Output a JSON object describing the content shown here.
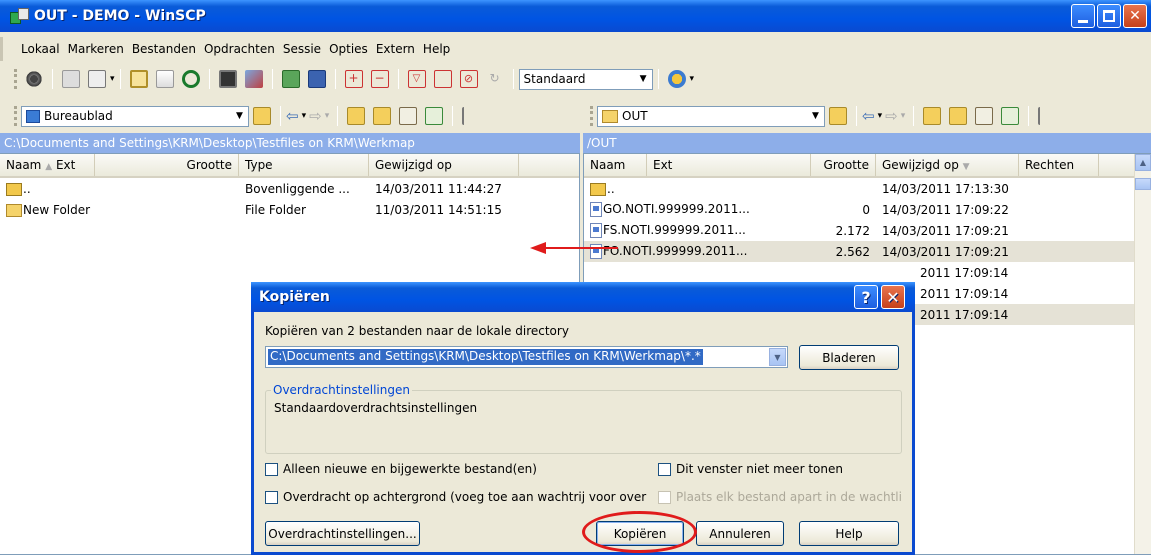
{
  "window": {
    "title": "OUT - DEMO - WinSCP"
  },
  "menu": [
    "Lokaal",
    "Markeren",
    "Bestanden",
    "Opdrachten",
    "Sessie",
    "Opties",
    "Extern",
    "Help"
  ],
  "toolbar": {
    "profile_value": "Standaard"
  },
  "left_panel": {
    "location": "Bureaublad",
    "path": "C:\\Documents and Settings\\KRM\\Desktop\\Testfiles on KRM\\Werkmap",
    "columns": {
      "name": "Naam",
      "ext": "Ext",
      "size": "Grootte",
      "type": "Type",
      "modified": "Gewijzigd op"
    },
    "rows": [
      {
        "name": "..",
        "size": "",
        "type": "Bovenliggende ...",
        "modified": "14/03/2011 11:44:27"
      },
      {
        "name": "New Folder",
        "size": "",
        "type": "File Folder",
        "modified": "11/03/2011 14:51:15"
      }
    ]
  },
  "right_panel": {
    "location": "OUT",
    "path": "/OUT",
    "columns": {
      "name": "Naam",
      "ext": "Ext",
      "size": "Grootte",
      "modified": "Gewijzigd op",
      "rights": "Rechten"
    },
    "rows": [
      {
        "name": "..",
        "size": "",
        "modified": "14/03/2011 17:13:30"
      },
      {
        "name": "GO.NOTI.999999.2011...",
        "size": "0",
        "modified": "14/03/2011 17:09:22"
      },
      {
        "name": "FS.NOTI.999999.2011...",
        "size": "2.172",
        "modified": "14/03/2011 17:09:21"
      },
      {
        "name": "FO.NOTI.999999.2011...",
        "size": "2.562",
        "modified": "14/03/2011 17:09:21"
      },
      {
        "name": "",
        "size": "",
        "modified": "2011 17:09:14"
      },
      {
        "name": "",
        "size": "",
        "modified": "2011 17:09:14"
      },
      {
        "name": "",
        "size": "",
        "modified": "2011 17:09:14"
      }
    ]
  },
  "dialog": {
    "title": "Kopiëren",
    "description": "Kopiëren van 2 bestanden naar de lokale directory",
    "target_path": "C:\\Documents and Settings\\KRM\\Desktop\\Testfiles on KRM\\Werkmap\\*.*",
    "browse_label": "Bladeren",
    "group_title": "Overdrachtinstellingen",
    "group_value": "Standaardoverdrachtsinstellingen",
    "check_new_only": "Alleen nieuwe en bijgewerkte bestand(en)",
    "check_dont_show": "Dit venster niet meer tonen",
    "check_background": "Overdracht op achtergrond (voeg toe aan wachtrij voor over",
    "check_separate": "Plaats elk bestand apart in de wachtli",
    "settings_button": "Overdrachtinstellingen...",
    "copy_button": "Kopiëren",
    "cancel_button": "Annuleren",
    "help_button": "Help"
  }
}
